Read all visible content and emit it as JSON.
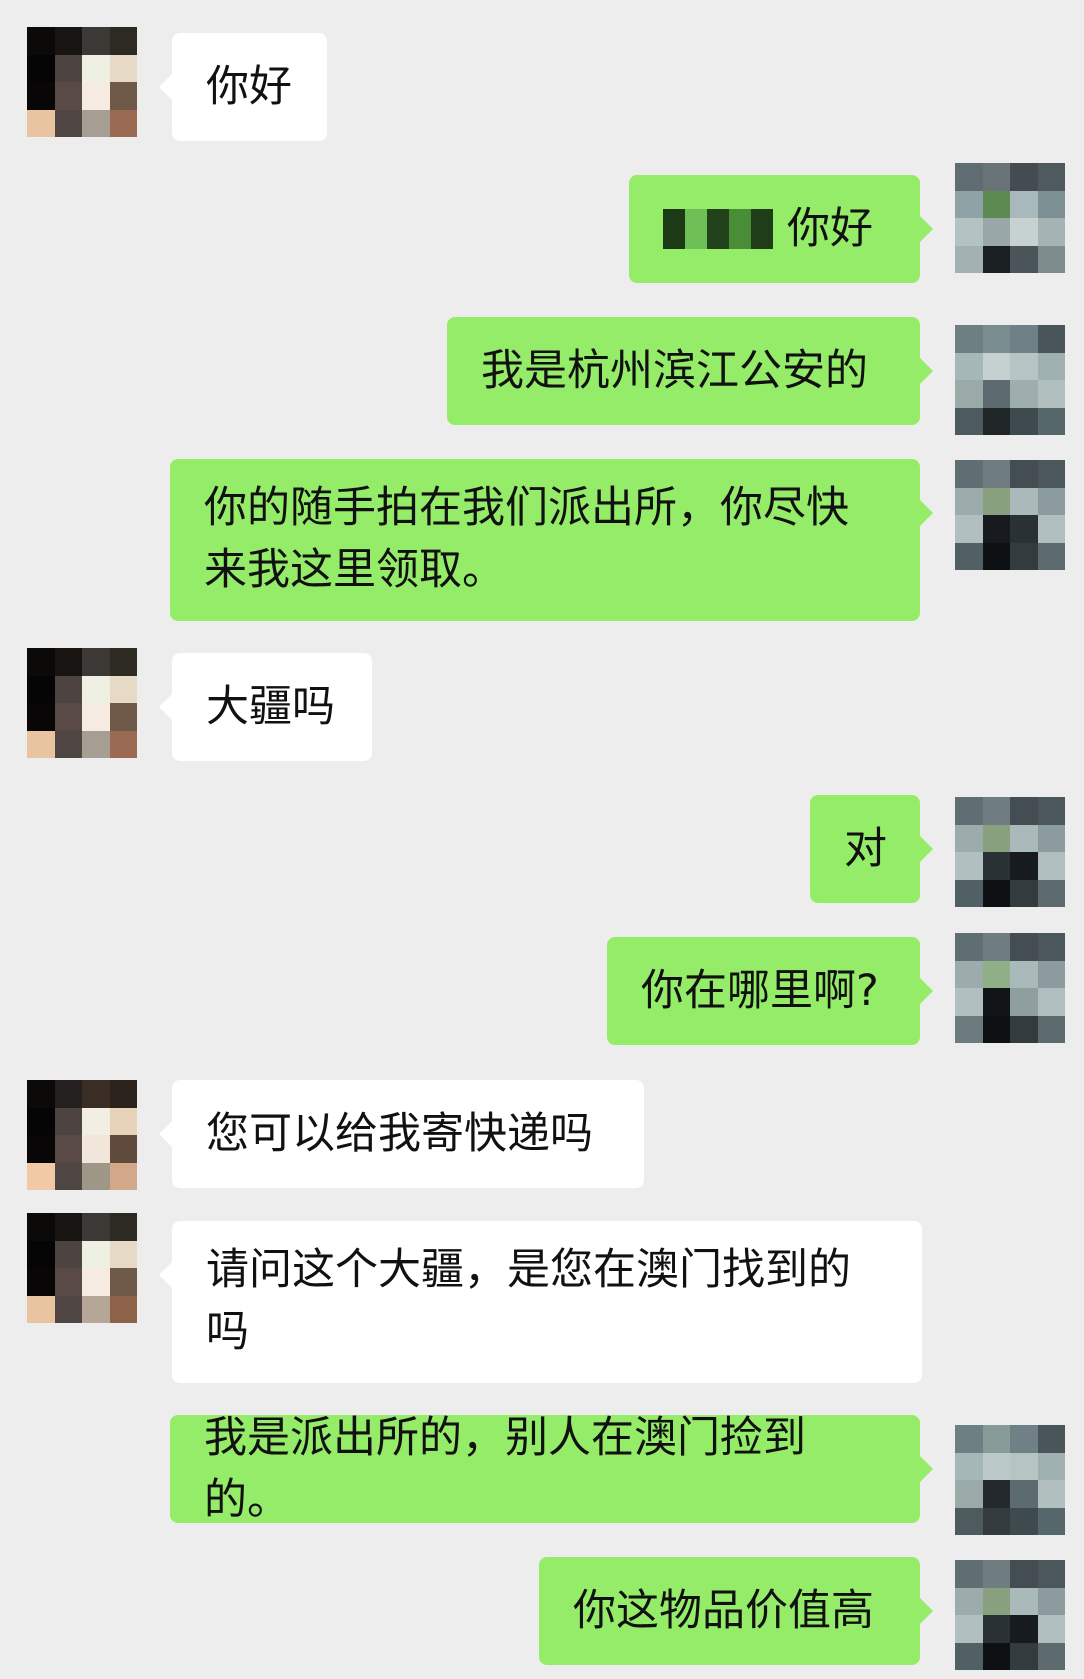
{
  "chat": {
    "messages": [
      {
        "side": "in",
        "text": "你好"
      },
      {
        "side": "out",
        "text": "你好",
        "redacted_prefix": true
      },
      {
        "side": "out",
        "text": "我是杭州滨江公安的"
      },
      {
        "side": "out",
        "text": "你的随手拍在我们派出所，你尽快来我这里领取。"
      },
      {
        "side": "in",
        "text": "大疆吗"
      },
      {
        "side": "out",
        "text": "对"
      },
      {
        "side": "out",
        "text": "你在哪里啊?"
      },
      {
        "side": "in",
        "text": "您可以给我寄快递吗"
      },
      {
        "side": "in",
        "text": "请问这个大疆，是您在澳门找到的吗"
      },
      {
        "side": "out",
        "text": "我是派出所的，别人在澳门捡到的。"
      },
      {
        "side": "out",
        "text": "你这物品价值高"
      }
    ]
  },
  "colors": {
    "background": "#ededed",
    "incoming_bubble": "#ffffff",
    "outgoing_bubble": "#95ec69"
  },
  "icons": {
    "incoming_avatar": "pixelated-avatar-icon",
    "outgoing_avatar": "pixelated-avatar-icon"
  }
}
